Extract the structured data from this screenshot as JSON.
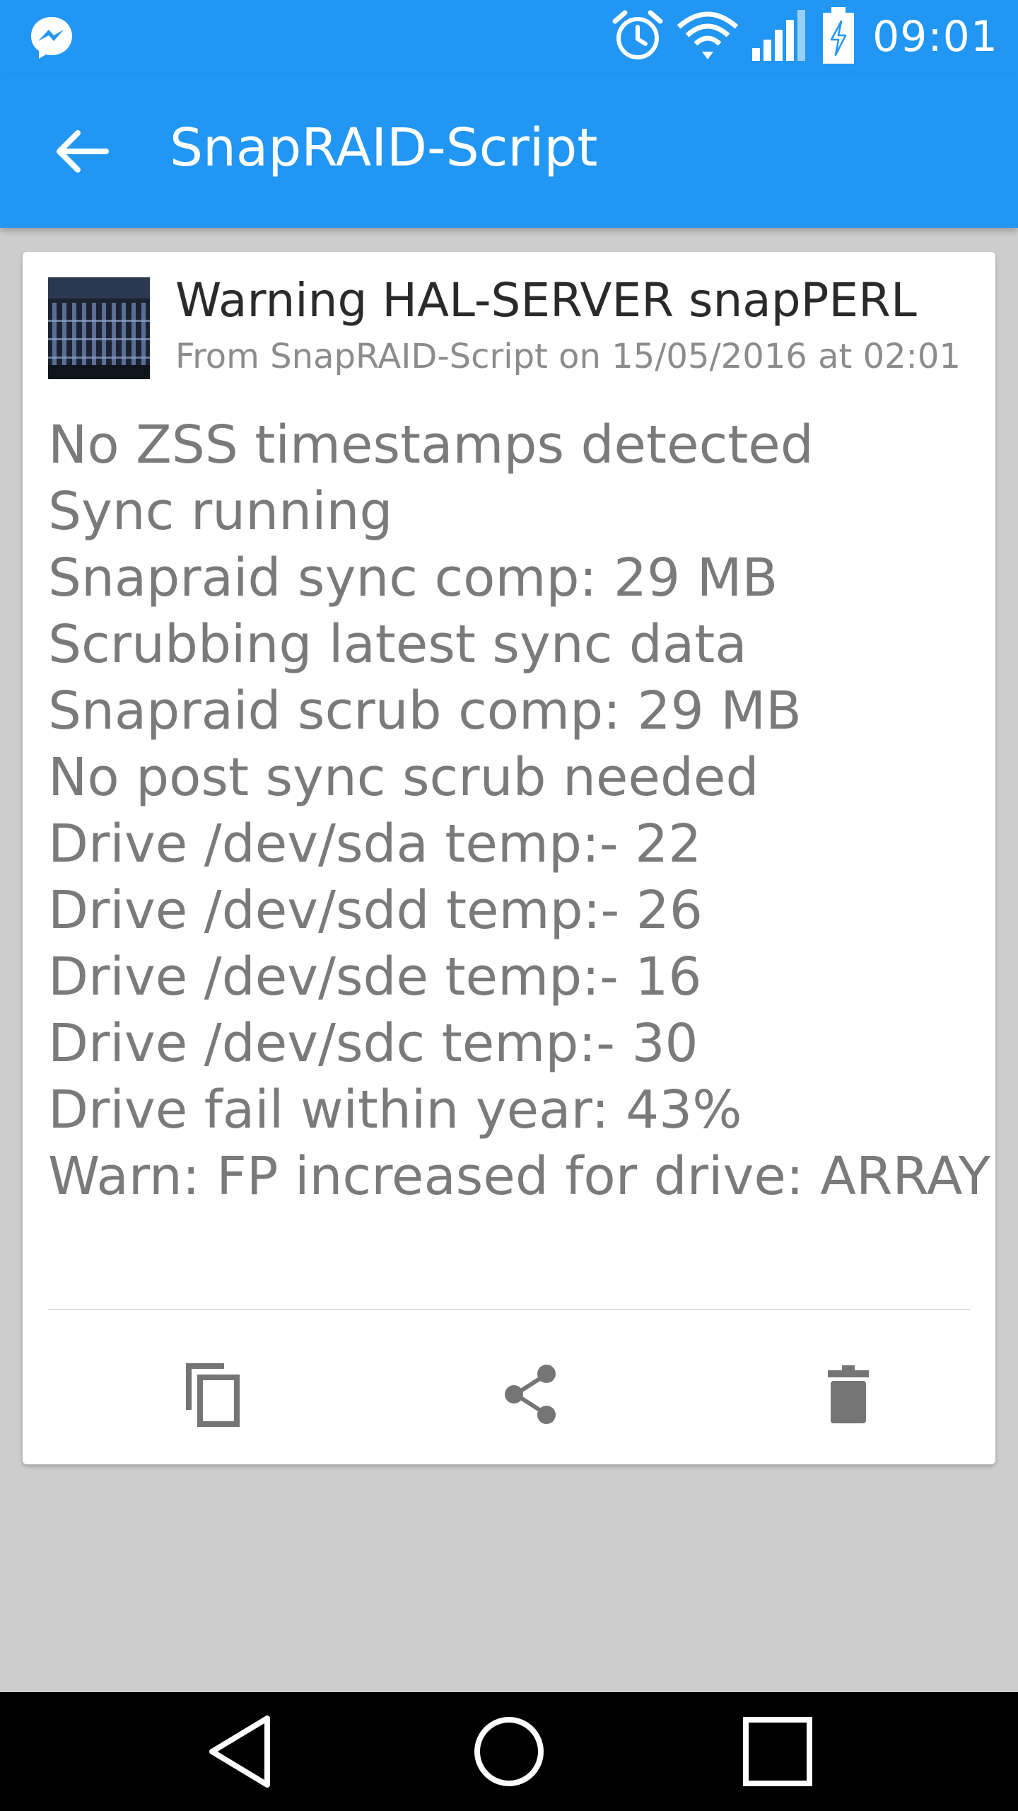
{
  "status_bar": {
    "time": "09:01",
    "left_icon": "messenger-icon",
    "right_icons": [
      "alarm-icon",
      "wifi-icon",
      "signal-icon",
      "battery-charging-icon"
    ]
  },
  "toolbar": {
    "title": "SnapRAID-Script",
    "back_icon": "arrow-back-icon"
  },
  "notification": {
    "title": "Warning HAL-SERVER snapPERL",
    "subtitle": "From SnapRAID-Script on 15/05/2016 at 02:01",
    "lines": [
      "No ZSS timestamps detected",
      "Sync running",
      "Snapraid sync comp: 29 MB",
      "Scrubbing latest sync data",
      "Snapraid scrub comp: 29 MB",
      "No post sync scrub needed",
      "Drive /dev/sda temp:- 22",
      "Drive /dev/sdd temp:- 26",
      "Drive /dev/sde temp:- 16",
      "Drive /dev/sdc temp:- 30",
      "Drive fail within year: 43%",
      "Warn: FP increased for drive: ARRAY"
    ],
    "actions": [
      "copy-icon",
      "share-icon",
      "delete-icon"
    ]
  },
  "nav_bar": {
    "buttons": [
      "back-triangle-icon",
      "home-circle-icon",
      "recents-square-icon"
    ]
  },
  "colors": {
    "primary": "#2196f3",
    "background": "#cdcdcd",
    "card": "#ffffff",
    "body_text": "#7a7a7a",
    "icon_gray": "#757575"
  }
}
